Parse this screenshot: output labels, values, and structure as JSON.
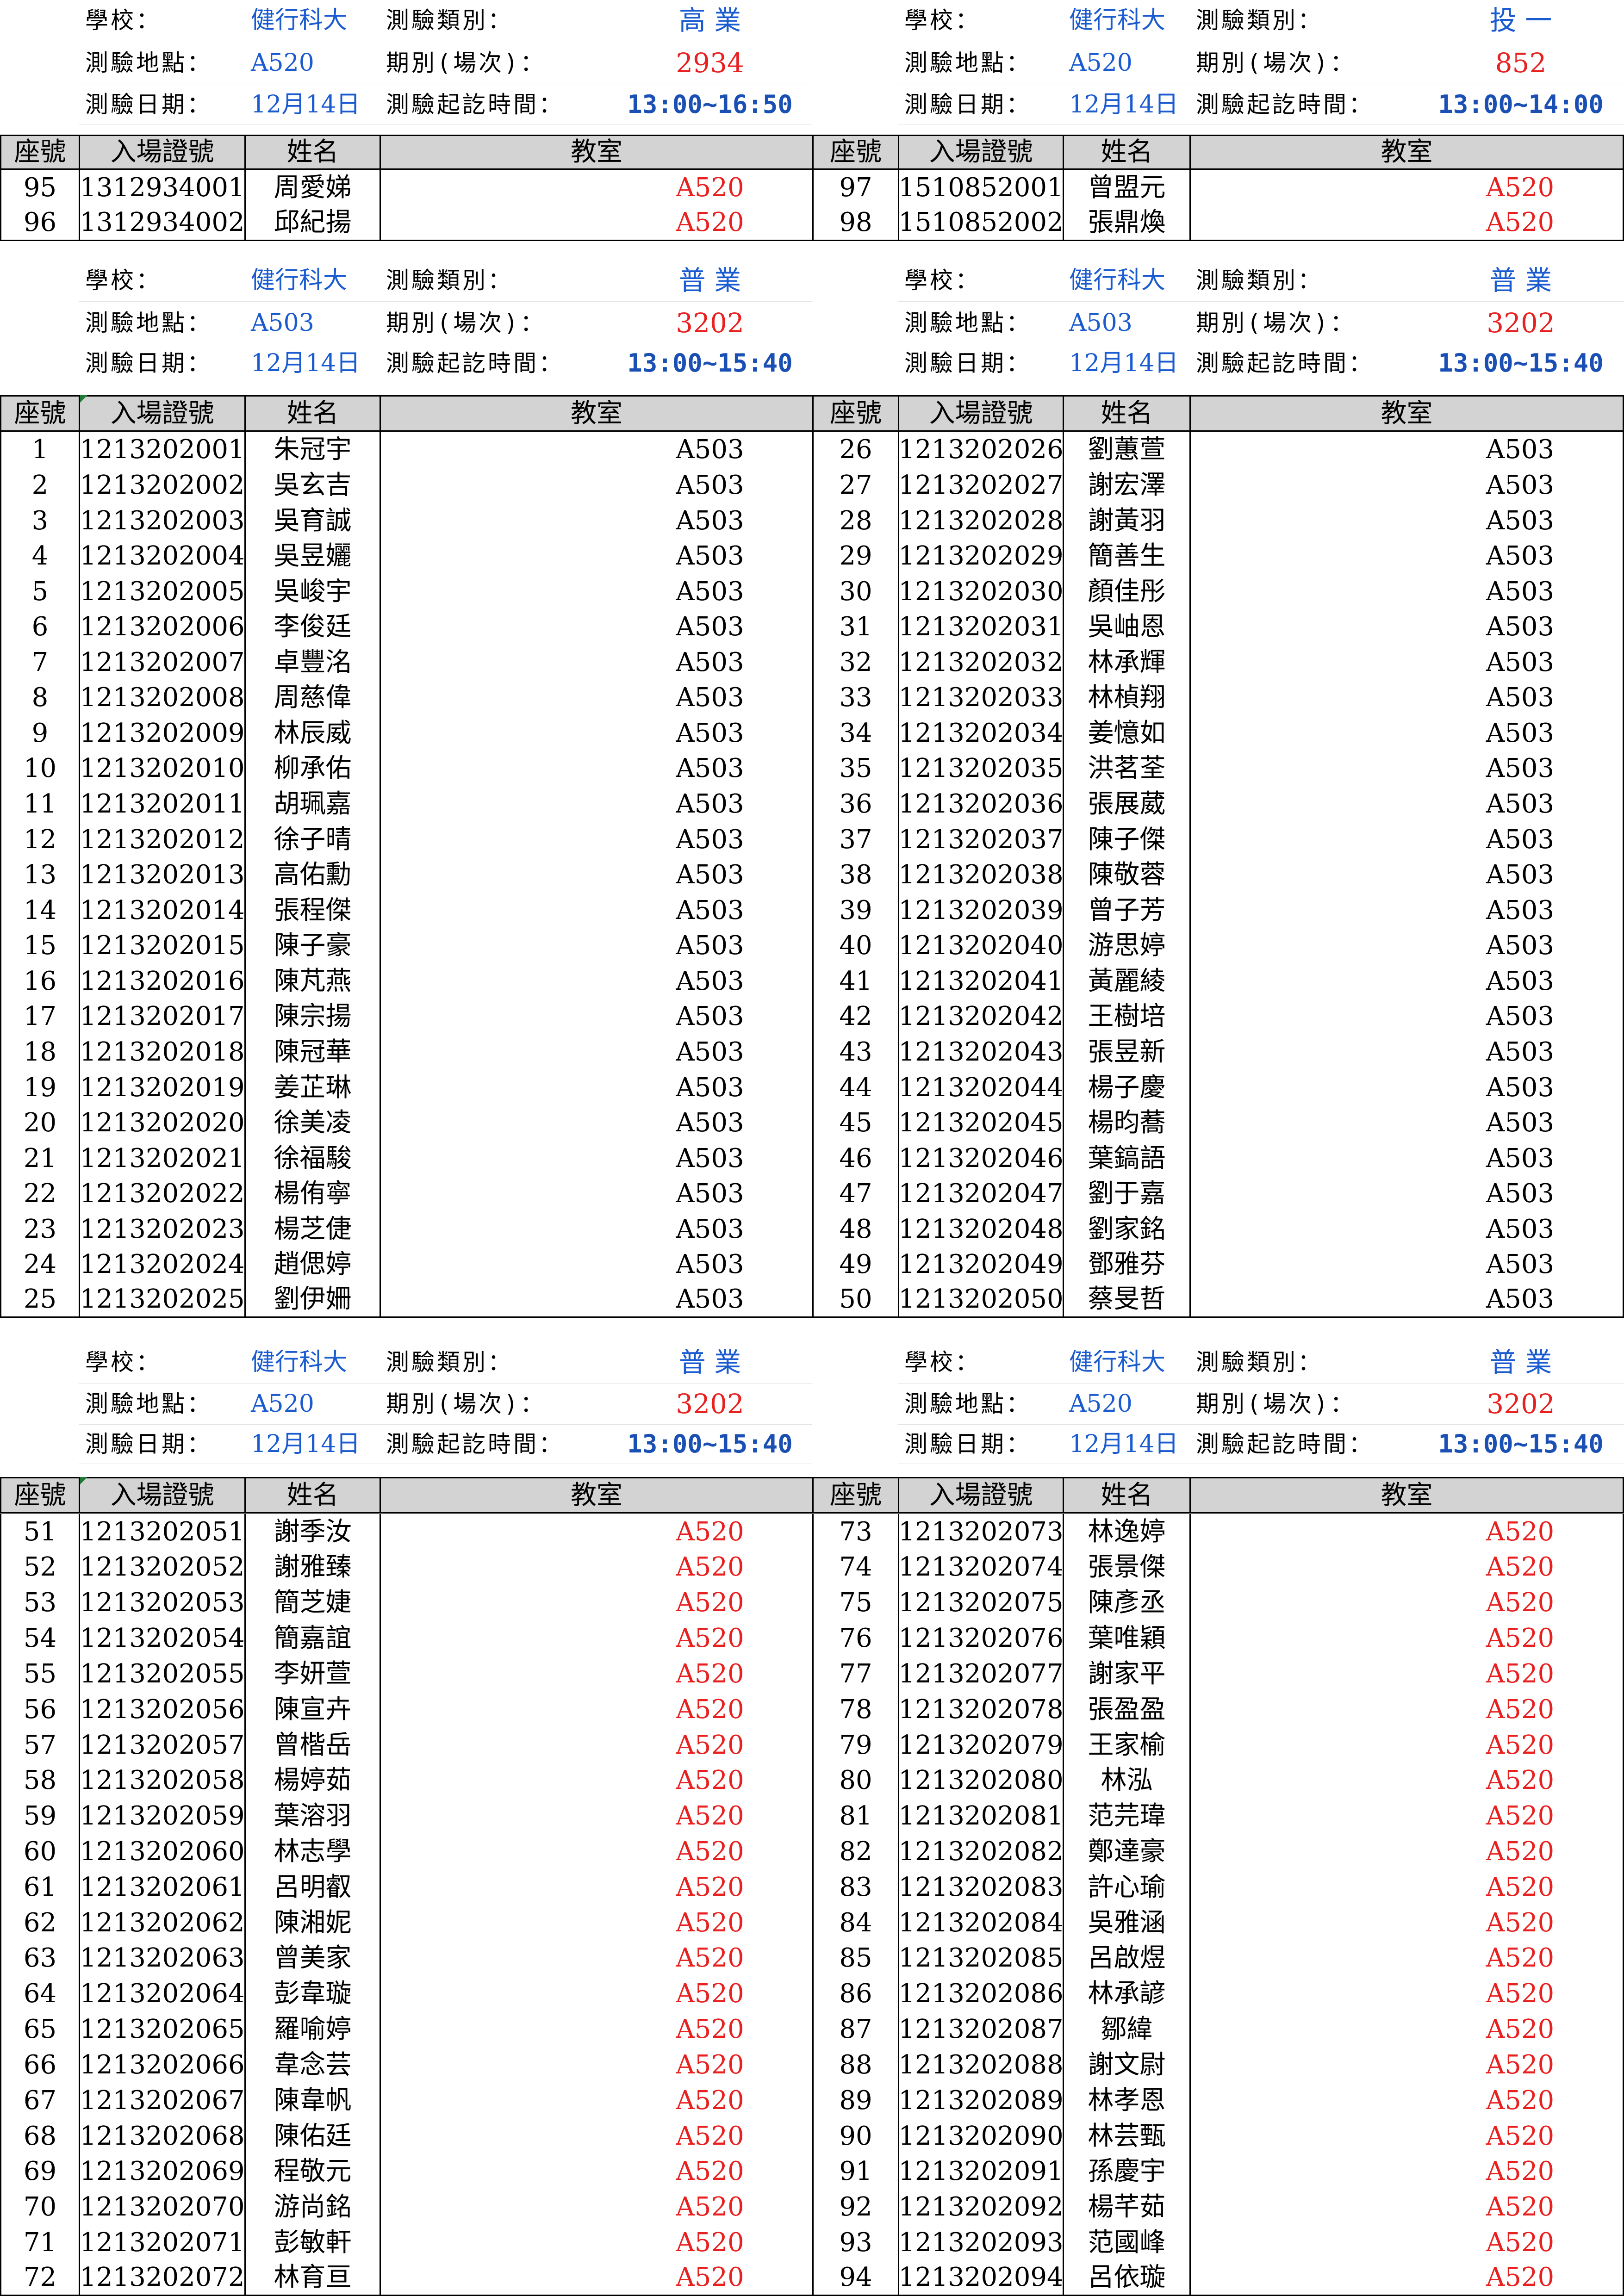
{
  "labels": {
    "school": "學校：",
    "location": "測驗地點：",
    "date": "測驗日期：",
    "category": "測驗類別：",
    "session": "期別(場次)：",
    "time": "測驗起訖時間：",
    "col_seat": "座號",
    "col_ticket": "入場證號",
    "col_name": "姓名",
    "col_room": "教室"
  },
  "sections": [
    {
      "left": {
        "school": "健行科大",
        "location": "A520",
        "date": "12月14日",
        "category": "高 業",
        "session": "2934",
        "time": "13:00~16:50"
      },
      "right": {
        "school": "健行科大",
        "location": "A520",
        "date": "12月14日",
        "category": "投 一",
        "session": "852",
        "time": "13:00~14:00"
      },
      "room_color": "#e8201f",
      "rows": [
        [
          [
            "95",
            "1312934001",
            "周愛娣",
            "A520"
          ],
          [
            "97",
            "1510852001",
            "曾盟元",
            "A520"
          ]
        ],
        [
          [
            "96",
            "1312934002",
            "邱紀揚",
            "A520"
          ],
          [
            "98",
            "1510852002",
            "張鼎煥",
            "A520"
          ]
        ]
      ]
    },
    {
      "left": {
        "school": "健行科大",
        "location": "A503",
        "date": "12月14日",
        "category": "普 業",
        "session": "3202",
        "time": "13:00~15:40"
      },
      "right": {
        "school": "健行科大",
        "location": "A503",
        "date": "12月14日",
        "category": "普 業",
        "session": "3202",
        "time": "13:00~15:40"
      },
      "room_color": "#000000",
      "rows": [
        [
          [
            "1",
            "1213202001",
            "朱冠宇",
            "A503"
          ],
          [
            "26",
            "1213202026",
            "劉蕙萱",
            "A503"
          ]
        ],
        [
          [
            "2",
            "1213202002",
            "吳玄吉",
            "A503"
          ],
          [
            "27",
            "1213202027",
            "謝宏澤",
            "A503"
          ]
        ],
        [
          [
            "3",
            "1213202003",
            "吳育誠",
            "A503"
          ],
          [
            "28",
            "1213202028",
            "謝黃羽",
            "A503"
          ]
        ],
        [
          [
            "4",
            "1213202004",
            "吳昱孋",
            "A503"
          ],
          [
            "29",
            "1213202029",
            "簡善生",
            "A503"
          ]
        ],
        [
          [
            "5",
            "1213202005",
            "吳峻宇",
            "A503"
          ],
          [
            "30",
            "1213202030",
            "顏佳彤",
            "A503"
          ]
        ],
        [
          [
            "6",
            "1213202006",
            "李俊廷",
            "A503"
          ],
          [
            "31",
            "1213202031",
            "吳岫恩",
            "A503"
          ]
        ],
        [
          [
            "7",
            "1213202007",
            "卓豐洺",
            "A503"
          ],
          [
            "32",
            "1213202032",
            "林承輝",
            "A503"
          ]
        ],
        [
          [
            "8",
            "1213202008",
            "周慈偉",
            "A503"
          ],
          [
            "33",
            "1213202033",
            "林楨翔",
            "A503"
          ]
        ],
        [
          [
            "9",
            "1213202009",
            "林辰威",
            "A503"
          ],
          [
            "34",
            "1213202034",
            "姜憶如",
            "A503"
          ]
        ],
        [
          [
            "10",
            "1213202010",
            "柳承佑",
            "A503"
          ],
          [
            "35",
            "1213202035",
            "洪茗荃",
            "A503"
          ]
        ],
        [
          [
            "11",
            "1213202011",
            "胡珮嘉",
            "A503"
          ],
          [
            "36",
            "1213202036",
            "張展葳",
            "A503"
          ]
        ],
        [
          [
            "12",
            "1213202012",
            "徐子晴",
            "A503"
          ],
          [
            "37",
            "1213202037",
            "陳子傑",
            "A503"
          ]
        ],
        [
          [
            "13",
            "1213202013",
            "高佑勳",
            "A503"
          ],
          [
            "38",
            "1213202038",
            "陳敬蓉",
            "A503"
          ]
        ],
        [
          [
            "14",
            "1213202014",
            "張程傑",
            "A503"
          ],
          [
            "39",
            "1213202039",
            "曾子芳",
            "A503"
          ]
        ],
        [
          [
            "15",
            "1213202015",
            "陳子豪",
            "A503"
          ],
          [
            "40",
            "1213202040",
            "游思婷",
            "A503"
          ]
        ],
        [
          [
            "16",
            "1213202016",
            "陳芃燕",
            "A503"
          ],
          [
            "41",
            "1213202041",
            "黃麗綾",
            "A503"
          ]
        ],
        [
          [
            "17",
            "1213202017",
            "陳宗揚",
            "A503"
          ],
          [
            "42",
            "1213202042",
            "王樹培",
            "A503"
          ]
        ],
        [
          [
            "18",
            "1213202018",
            "陳冠華",
            "A503"
          ],
          [
            "43",
            "1213202043",
            "張昱新",
            "A503"
          ]
        ],
        [
          [
            "19",
            "1213202019",
            "姜芷琳",
            "A503"
          ],
          [
            "44",
            "1213202044",
            "楊子慶",
            "A503"
          ]
        ],
        [
          [
            "20",
            "1213202020",
            "徐美凌",
            "A503"
          ],
          [
            "45",
            "1213202045",
            "楊昀蕎",
            "A503"
          ]
        ],
        [
          [
            "21",
            "1213202021",
            "徐福駿",
            "A503"
          ],
          [
            "46",
            "1213202046",
            "葉鎬語",
            "A503"
          ]
        ],
        [
          [
            "22",
            "1213202022",
            "楊侑寧",
            "A503"
          ],
          [
            "47",
            "1213202047",
            "劉于嘉",
            "A503"
          ]
        ],
        [
          [
            "23",
            "1213202023",
            "楊芝倢",
            "A503"
          ],
          [
            "48",
            "1213202048",
            "劉家銘",
            "A503"
          ]
        ],
        [
          [
            "24",
            "1213202024",
            "趙偲婷",
            "A503"
          ],
          [
            "49",
            "1213202049",
            "鄧雅芬",
            "A503"
          ]
        ],
        [
          [
            "25",
            "1213202025",
            "劉伊姍",
            "A503"
          ],
          [
            "50",
            "1213202050",
            "蔡旻哲",
            "A503"
          ]
        ]
      ]
    },
    {
      "left": {
        "school": "健行科大",
        "location": "A520",
        "date": "12月14日",
        "category": "普 業",
        "session": "3202",
        "time": "13:00~15:40"
      },
      "right": {
        "school": "健行科大",
        "location": "A520",
        "date": "12月14日",
        "category": "普 業",
        "session": "3202",
        "time": "13:00~15:40"
      },
      "room_color": "#e8201f",
      "rows": [
        [
          [
            "51",
            "1213202051",
            "謝季汝",
            "A520"
          ],
          [
            "73",
            "1213202073",
            "林逸婷",
            "A520"
          ]
        ],
        [
          [
            "52",
            "1213202052",
            "謝雅臻",
            "A520"
          ],
          [
            "74",
            "1213202074",
            "張景傑",
            "A520"
          ]
        ],
        [
          [
            "53",
            "1213202053",
            "簡芝婕",
            "A520"
          ],
          [
            "75",
            "1213202075",
            "陳彥丞",
            "A520"
          ]
        ],
        [
          [
            "54",
            "1213202054",
            "簡嘉誼",
            "A520"
          ],
          [
            "76",
            "1213202076",
            "葉唯穎",
            "A520"
          ]
        ],
        [
          [
            "55",
            "1213202055",
            "李妍萱",
            "A520"
          ],
          [
            "77",
            "1213202077",
            "謝家平",
            "A520"
          ]
        ],
        [
          [
            "56",
            "1213202056",
            "陳宣卉",
            "A520"
          ],
          [
            "78",
            "1213202078",
            "張盈盈",
            "A520"
          ]
        ],
        [
          [
            "57",
            "1213202057",
            "曾楷岳",
            "A520"
          ],
          [
            "79",
            "1213202079",
            "王家榆",
            "A520"
          ]
        ],
        [
          [
            "58",
            "1213202058",
            "楊婷茹",
            "A520"
          ],
          [
            "80",
            "1213202080",
            "林泓",
            "A520"
          ]
        ],
        [
          [
            "59",
            "1213202059",
            "葉溶羽",
            "A520"
          ],
          [
            "81",
            "1213202081",
            "范芫瑋",
            "A520"
          ]
        ],
        [
          [
            "60",
            "1213202060",
            "林志學",
            "A520"
          ],
          [
            "82",
            "1213202082",
            "鄭達豪",
            "A520"
          ]
        ],
        [
          [
            "61",
            "1213202061",
            "呂明叡",
            "A520"
          ],
          [
            "83",
            "1213202083",
            "許心瑜",
            "A520"
          ]
        ],
        [
          [
            "62",
            "1213202062",
            "陳湘妮",
            "A520"
          ],
          [
            "84",
            "1213202084",
            "吳雅涵",
            "A520"
          ]
        ],
        [
          [
            "63",
            "1213202063",
            "曾美家",
            "A520"
          ],
          [
            "85",
            "1213202085",
            "呂啟煜",
            "A520"
          ]
        ],
        [
          [
            "64",
            "1213202064",
            "彭韋璇",
            "A520"
          ],
          [
            "86",
            "1213202086",
            "林承諺",
            "A520"
          ]
        ],
        [
          [
            "65",
            "1213202065",
            "羅喻婷",
            "A520"
          ],
          [
            "87",
            "1213202087",
            "鄒緯",
            "A520"
          ]
        ],
        [
          [
            "66",
            "1213202066",
            "韋念芸",
            "A520"
          ],
          [
            "88",
            "1213202088",
            "謝文尉",
            "A520"
          ]
        ],
        [
          [
            "67",
            "1213202067",
            "陳韋帆",
            "A520"
          ],
          [
            "89",
            "1213202089",
            "林孝恩",
            "A520"
          ]
        ],
        [
          [
            "68",
            "1213202068",
            "陳佑廷",
            "A520"
          ],
          [
            "90",
            "1213202090",
            "林芸甄",
            "A520"
          ]
        ],
        [
          [
            "69",
            "1213202069",
            "程敬元",
            "A520"
          ],
          [
            "91",
            "1213202091",
            "孫慶宇",
            "A520"
          ]
        ],
        [
          [
            "70",
            "1213202070",
            "游尚銘",
            "A520"
          ],
          [
            "92",
            "1213202092",
            "楊芊茹",
            "A520"
          ]
        ],
        [
          [
            "71",
            "1213202071",
            "彭敏軒",
            "A520"
          ],
          [
            "93",
            "1213202093",
            "范國峰",
            "A520"
          ]
        ],
        [
          [
            "72",
            "1213202072",
            "林育亘",
            "A520"
          ],
          [
            "94",
            "1213202094",
            "呂依璇",
            "A520"
          ]
        ]
      ]
    }
  ]
}
